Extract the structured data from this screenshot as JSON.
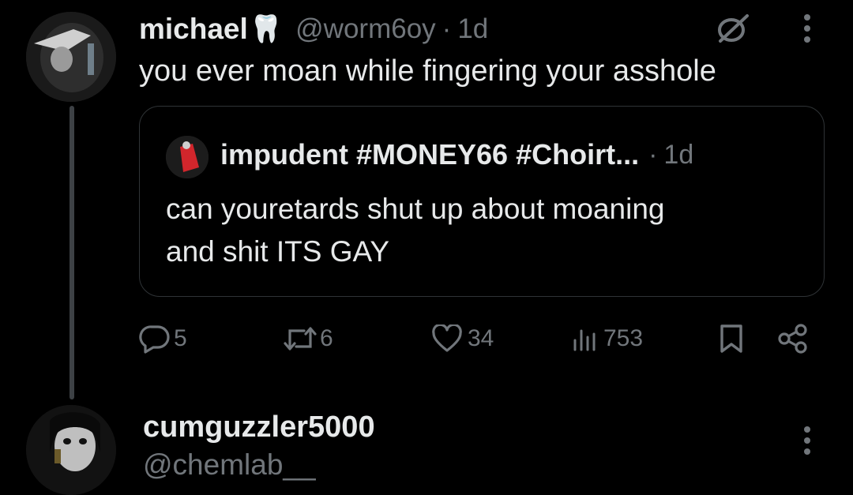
{
  "tweet": {
    "author_name": "michael",
    "author_emoji": "🦷",
    "author_handle": "@worm6oy",
    "separator": "·",
    "time": "1d",
    "text": "you ever moan while fingering your asshole"
  },
  "quote": {
    "author_name": "impudent #MONEY66 #Choirt...",
    "separator": "·",
    "time": "1d",
    "text_line1": "can youretards shut up about moaning",
    "text_line2": "and shit ITS GAY"
  },
  "actions": {
    "replies": "5",
    "reposts": "6",
    "likes": "34",
    "views": "753"
  },
  "reply_user": {
    "name": "cumguzzler5000",
    "handle": "@chemlab__"
  },
  "icons": {
    "grok": "grok-slash-icon",
    "more": "more-dots-icon",
    "reply": "reply-bubble-icon",
    "repost": "repost-arrows-icon",
    "like": "heart-icon",
    "views": "views-bars-icon",
    "bookmark": "bookmark-icon",
    "share": "share-icon"
  },
  "colors": {
    "background": "#000000",
    "text": "#e7e9ea",
    "muted": "#71767b",
    "border": "#2f3336"
  }
}
